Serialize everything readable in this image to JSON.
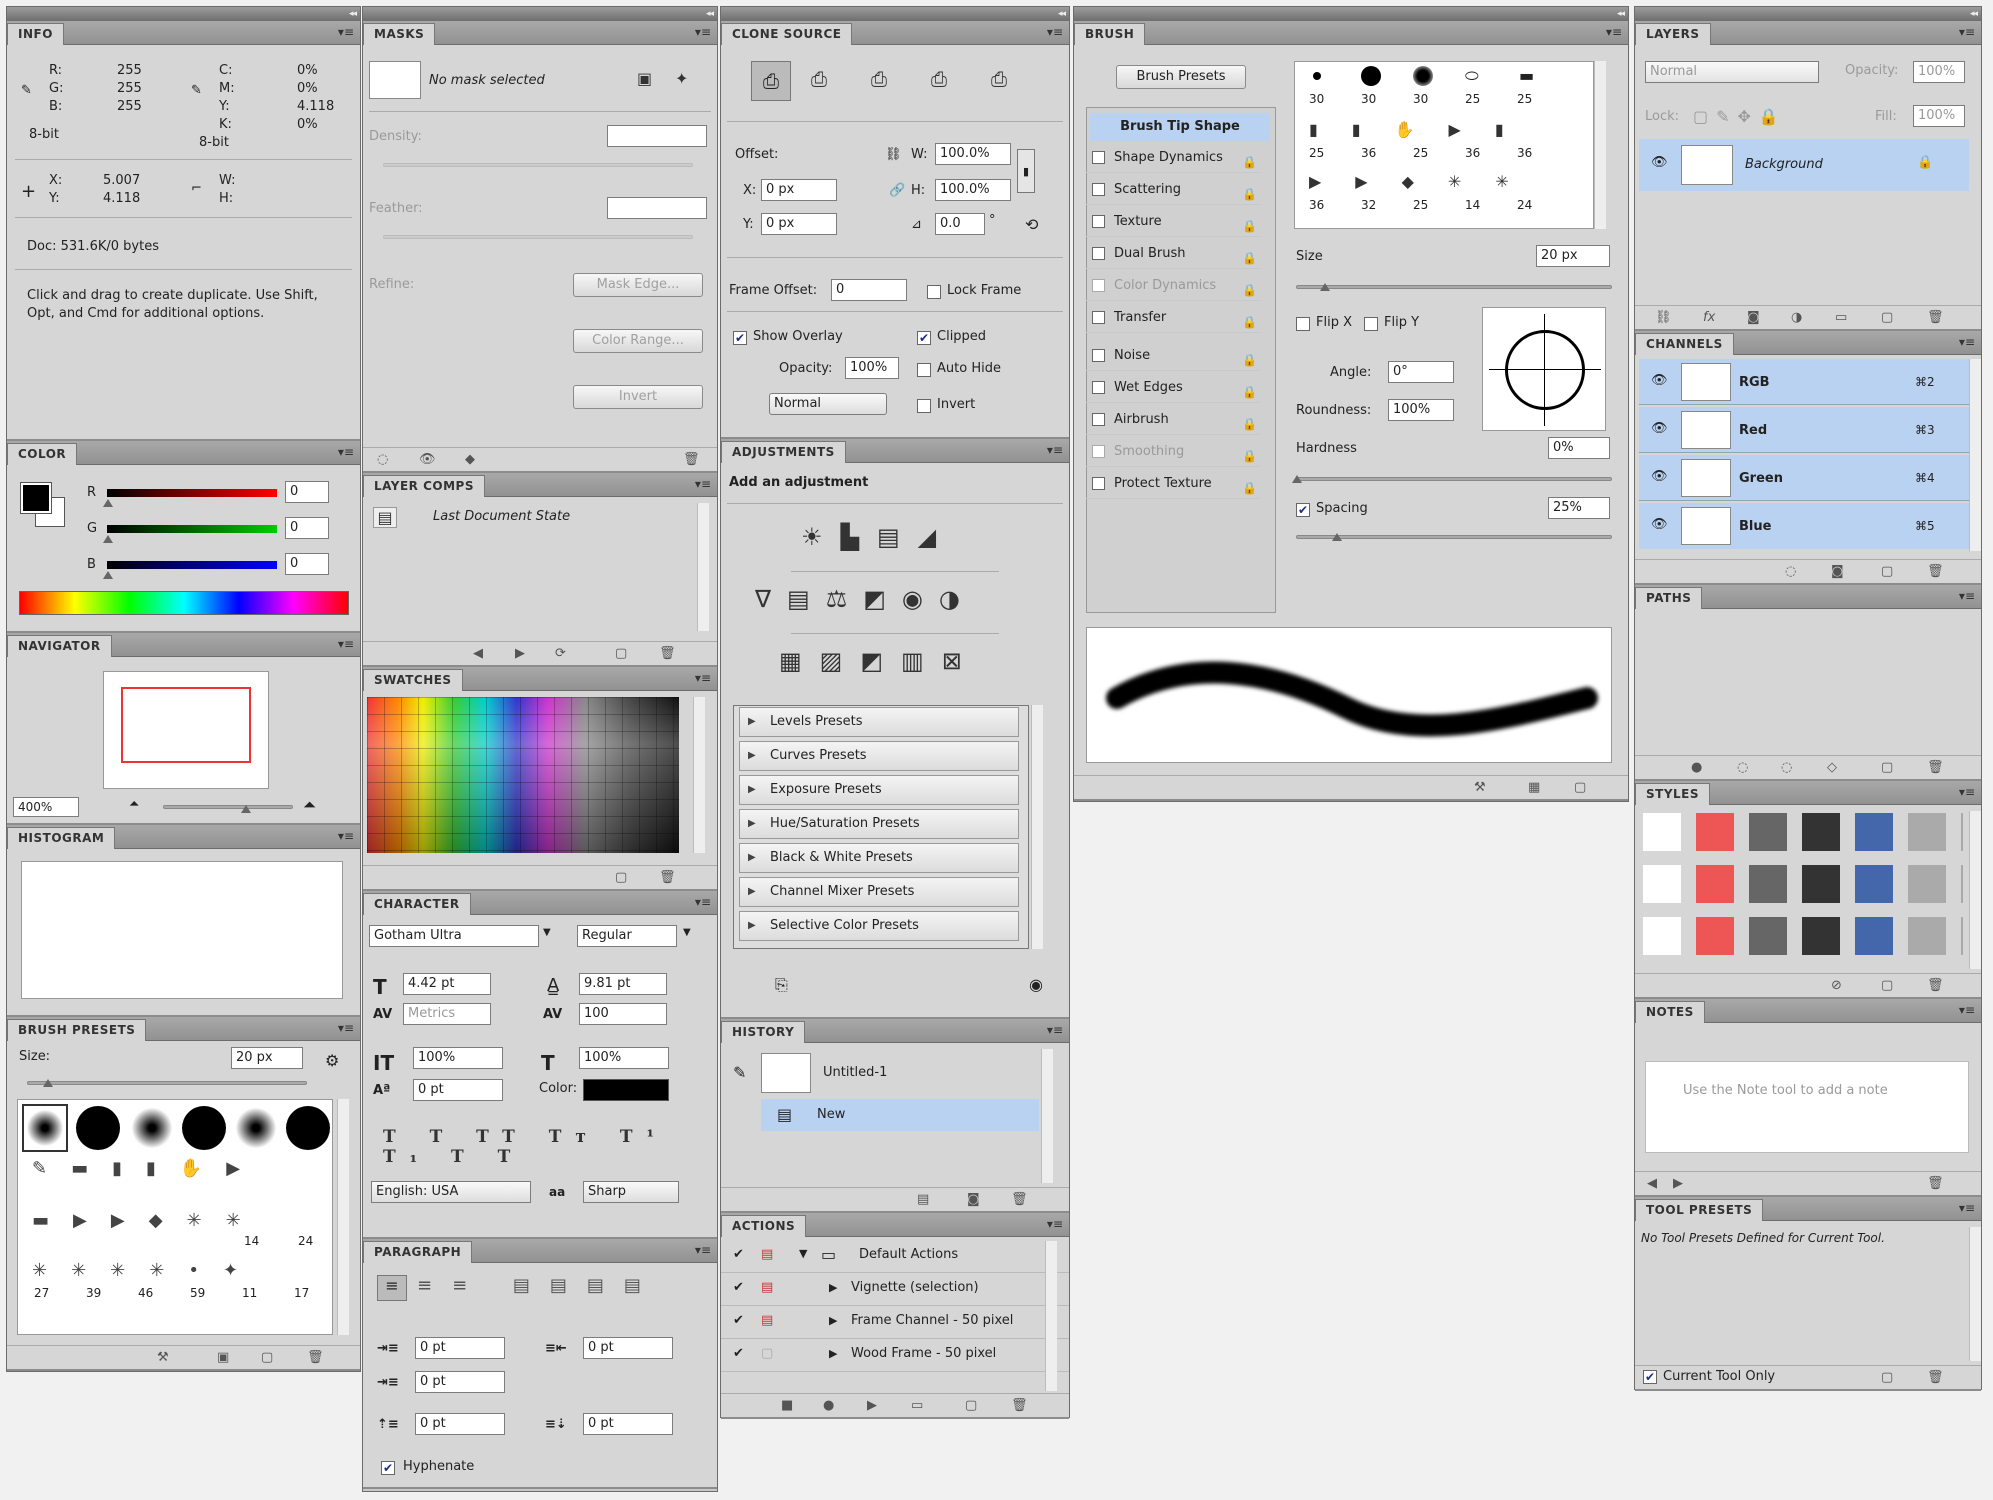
{
  "info": {
    "tab": "INFO",
    "rl": "R:",
    "gl": "G:",
    "bl": "B:",
    "r": "255",
    "g": "255",
    "b": "255",
    "cl": "C:",
    "ml": "M:",
    "yl": "Y:",
    "kl": "K:",
    "c": "0%",
    "m": "0%",
    "y": "4.118",
    "k": "0%",
    "bit1": "8-bit",
    "bit2": "8-bit",
    "xl": "X:",
    "yl2": "Y:",
    "x": "5.007",
    "wl": "W:",
    "hl": "H:",
    "doc": "Doc: 531.6K/0 bytes",
    "hint": "Click and drag to create duplicate.  Use Shift, Opt, and Cmd for additional options."
  },
  "color": {
    "tab": "COLOR",
    "rl": "R",
    "gl": "G",
    "bl": "B",
    "r": "0",
    "g": "0",
    "b": "0"
  },
  "navigator": {
    "tab": "NAVIGATOR",
    "zoom": "400%"
  },
  "histogram": {
    "tab": "HISTOGRAM"
  },
  "brushpresets": {
    "tab": "BRUSH PRESETS",
    "size_label": "Size:",
    "size": "20 px",
    "row4": [
      "27",
      "39",
      "46",
      "59",
      "11",
      "17"
    ],
    "row3": [
      "14",
      "24"
    ]
  },
  "masks": {
    "tab": "MASKS",
    "none": "No mask selected",
    "density": "Density:",
    "feather": "Feather:",
    "refine": "Refine:",
    "mask_edge": "Mask Edge...",
    "color_range": "Color Range...",
    "invert": "Invert"
  },
  "layercomps": {
    "tab": "LAYER COMPS",
    "state": "Last Document State"
  },
  "swatches": {
    "tab": "SWATCHES"
  },
  "character": {
    "tab": "CHARACTER",
    "font": "Gotham Ultra",
    "style": "Regular",
    "size": "4.42 pt",
    "leading": "9.81 pt",
    "kerning": "Metrics",
    "tracking": "100",
    "vscale": "100%",
    "hscale": "100%",
    "baseline": "0 pt",
    "color_label": "Color:",
    "lang": "English: USA",
    "aa": "Sharp"
  },
  "paragraph": {
    "tab": "PARAGRAPH",
    "li": "0 pt",
    "ri": "0 pt",
    "fi": "0 pt",
    "sb": "0 pt",
    "sa": "0 pt",
    "hyph": "Hyphenate"
  },
  "clonesource": {
    "tab": "CLONE SOURCE",
    "offset": "Offset:",
    "w": "100.0%",
    "h": "100.0%",
    "x": "0 px",
    "y": "0 px",
    "angle": "0.0",
    "deg": "°",
    "wl": "W:",
    "hl": "H:",
    "xl": "X:",
    "yl": "Y:",
    "frame_offset": "Frame Offset:",
    "frame_val": "0",
    "lock_frame": "Lock Frame",
    "show_overlay": "Show Overlay",
    "clipped": "Clipped",
    "opacity_label": "Opacity:",
    "opacity": "100%",
    "auto_hide": "Auto Hide",
    "mode": "Normal",
    "invert": "Invert"
  },
  "adjustments": {
    "tab": "ADJUSTMENTS",
    "title": "Add an adjustment",
    "presets": [
      "Levels Presets",
      "Curves Presets",
      "Exposure Presets",
      "Hue/Saturation Presets",
      "Black & White Presets",
      "Channel Mixer Presets",
      "Selective Color Presets"
    ]
  },
  "history": {
    "tab": "HISTORY",
    "doc": "Untitled-1",
    "item": "New"
  },
  "actions": {
    "tab": "ACTIONS",
    "set": "Default Actions",
    "items": [
      "Vignette (selection)",
      "Frame Channel - 50 pixel",
      "Wood Frame - 50 pixel"
    ]
  },
  "brush": {
    "tab": "BRUSH",
    "presets_btn": "Brush Presets",
    "options": [
      "Brush Tip Shape",
      "Shape Dynamics",
      "Scattering",
      "Texture",
      "Dual Brush",
      "Color Dynamics",
      "Transfer",
      "Noise",
      "Wet Edges",
      "Airbrush",
      "Smoothing",
      "Protect Texture"
    ],
    "tips_r1": [
      "30",
      "30",
      "30",
      "25",
      "25"
    ],
    "tips_r2": [
      "25",
      "36",
      "25",
      "36",
      "36"
    ],
    "tips_r3": [
      "36",
      "32",
      "25",
      "14",
      "24"
    ],
    "size_label": "Size",
    "size": "20 px",
    "flipx": "Flip X",
    "flipy": "Flip Y",
    "angle_label": "Angle:",
    "angle": "0°",
    "round_label": "Roundness:",
    "round": "100%",
    "hard_label": "Hardness",
    "hard": "0%",
    "spacing": "Spacing",
    "spacing_val": "25%"
  },
  "layers": {
    "tab": "LAYERS",
    "mode": "Normal",
    "opacity_label": "Opacity:",
    "opacity": "100%",
    "lock": "Lock:",
    "fill_label": "Fill:",
    "fill": "100%",
    "layer": "Background"
  },
  "channels": {
    "tab": "CHANNELS",
    "items": [
      {
        "name": "RGB",
        "key": "⌘2"
      },
      {
        "name": "Red",
        "key": "⌘3"
      },
      {
        "name": "Green",
        "key": "⌘4"
      },
      {
        "name": "Blue",
        "key": "⌘5"
      }
    ]
  },
  "paths": {
    "tab": "PATHS"
  },
  "styles": {
    "tab": "STYLES"
  },
  "notes": {
    "tab": "NOTES",
    "hint": "Use the Note tool to add a note"
  },
  "toolpresets": {
    "tab": "TOOL PRESETS",
    "none": "No Tool Presets Defined for Current Tool.",
    "current": "Current Tool Only"
  }
}
